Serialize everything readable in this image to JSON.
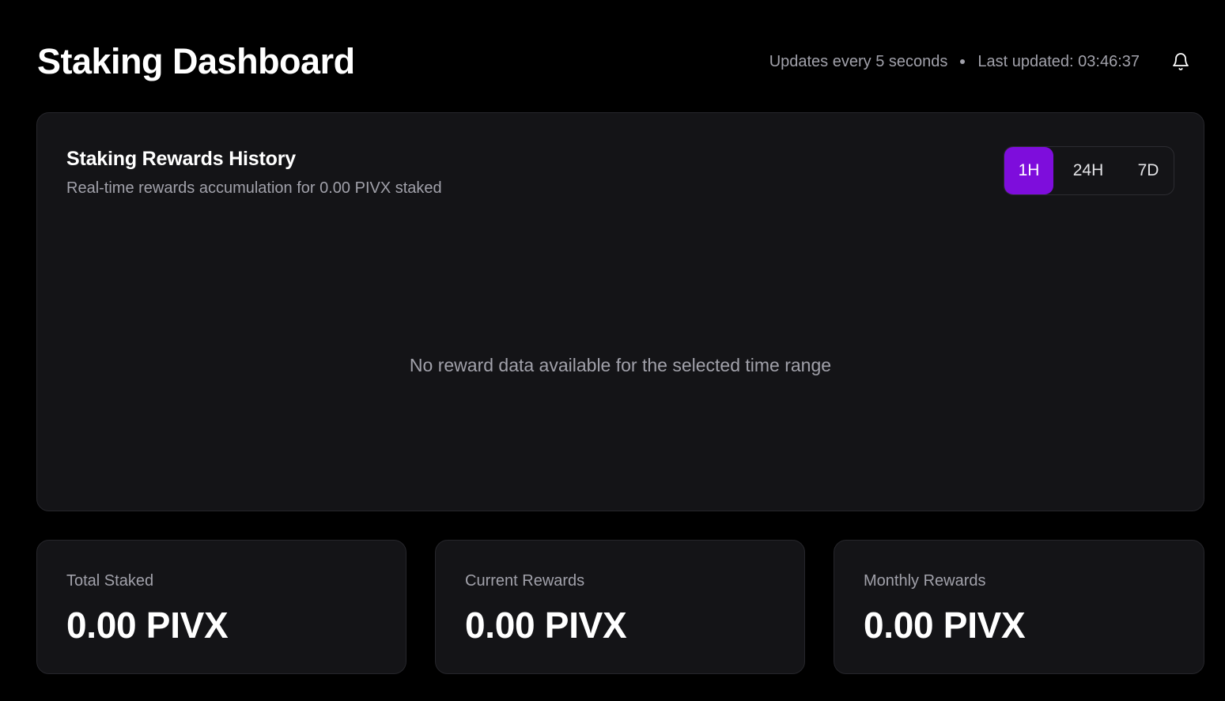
{
  "header": {
    "title": "Staking Dashboard",
    "update_interval": "Updates every 5 seconds",
    "last_updated": "Last updated: 03:46:37",
    "notification_icon": "bell-icon"
  },
  "rewards_chart": {
    "title": "Staking Rewards History",
    "subtitle": "Real-time rewards accumulation for 0.00 PIVX staked",
    "range_tabs": [
      "1H",
      "24H",
      "7D"
    ],
    "selected_range": "1H",
    "empty_message": "No reward data available for the selected time range"
  },
  "stats": [
    {
      "label": "Total Staked",
      "value": "0.00 PIVX"
    },
    {
      "label": "Current Rewards",
      "value": "0.00 PIVX"
    },
    {
      "label": "Monthly Rewards",
      "value": "0.00 PIVX"
    }
  ],
  "colors": {
    "background": "#000000",
    "card": "#141417",
    "accent": "#7e0ddc",
    "muted_text": "#a1a1aa"
  }
}
